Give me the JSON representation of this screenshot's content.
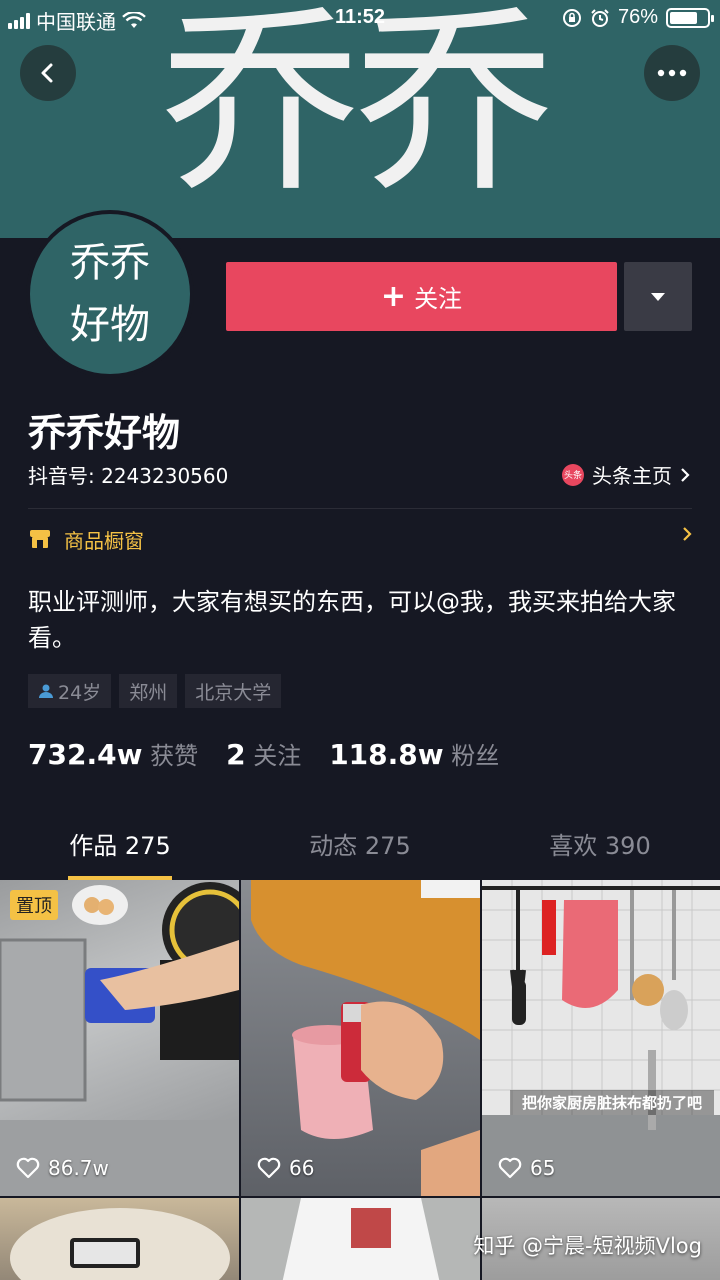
{
  "status_bar": {
    "carrier": "中国联通",
    "time": "11:52",
    "battery": "76%",
    "battery_level": 0.76
  },
  "cover": {
    "text": "乔乔"
  },
  "avatar": {
    "line1": "乔乔",
    "line2": "好物"
  },
  "actions": {
    "follow_label": "关注"
  },
  "profile": {
    "name": "乔乔好物",
    "douyin_id": "抖音号: 2243230560",
    "toutiao_label": "头条主页",
    "toutiao_logo": "头条",
    "shop_label": "商品橱窗",
    "bio": "职业评测师，大家有想买的东西，可以@我，我买来拍给大家看。",
    "tags": [
      "24岁",
      "郑州",
      "北京大学"
    ]
  },
  "stats": [
    {
      "value": "732.4w",
      "label": "获赞"
    },
    {
      "value": "2",
      "label": "关注"
    },
    {
      "value": "118.8w",
      "label": "粉丝"
    }
  ],
  "tabs": [
    {
      "label": "作品 275",
      "active": true
    },
    {
      "label": "动态 275",
      "active": false
    },
    {
      "label": "喜欢 390",
      "active": false
    }
  ],
  "videos": [
    {
      "likes": "86.7w",
      "pinned_label": "置顶"
    },
    {
      "likes": "66"
    },
    {
      "likes": "65",
      "caption": "把你家厨房脏抹布都扔了吧"
    }
  ],
  "watermark": "知乎 @宁晨-短视频Vlog",
  "colors": {
    "accent": "#e8475f",
    "gold": "#f4c145",
    "background": "#161823",
    "cover": "#2f6466"
  }
}
